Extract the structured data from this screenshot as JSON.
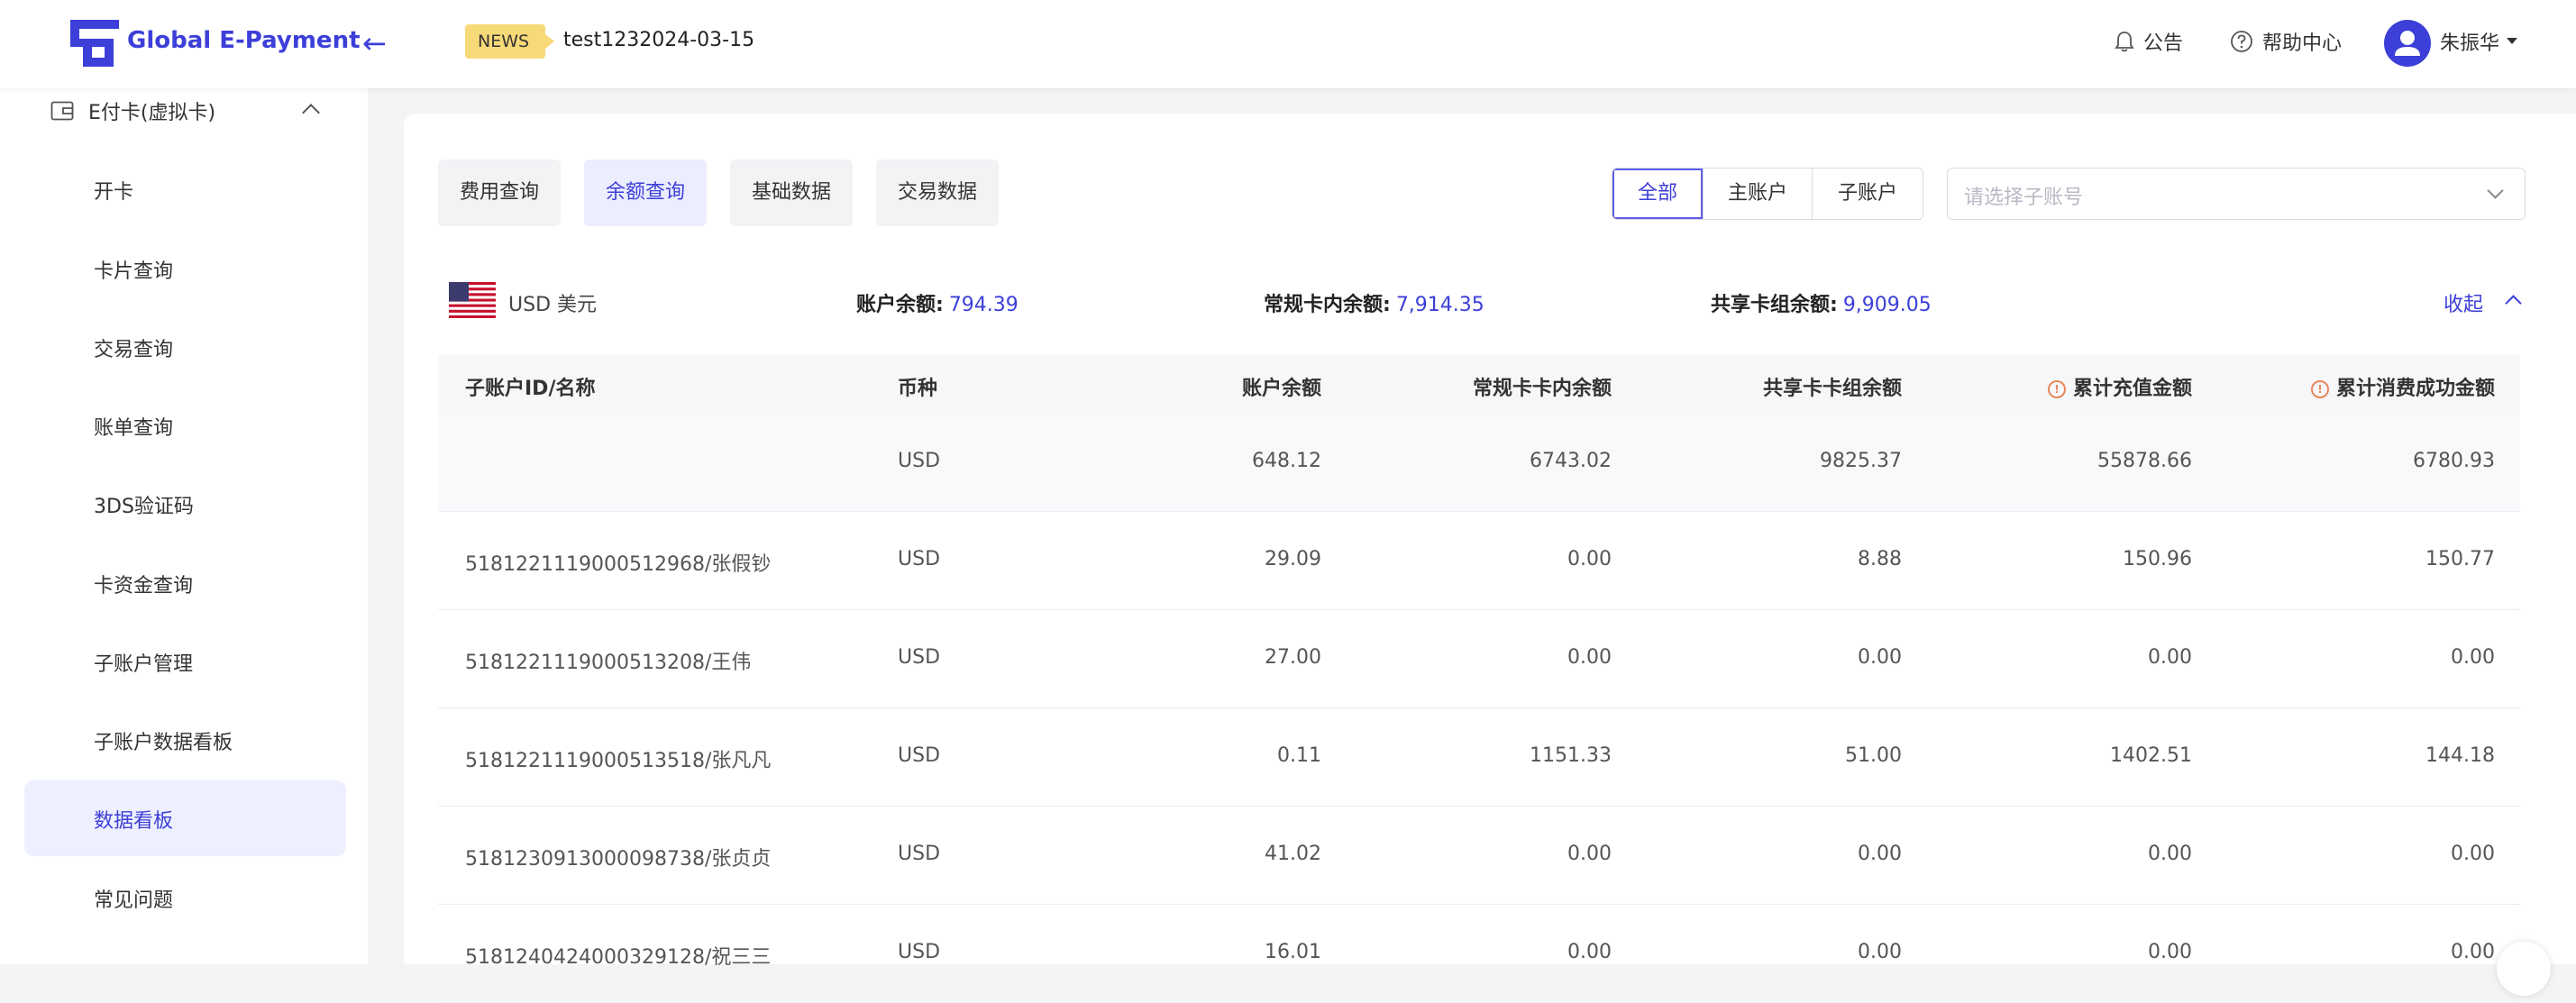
{
  "header": {
    "logo_text": "Global E-Payment",
    "news_badge": "NEWS",
    "news_text": "test1232024-03-15",
    "notice_label": "公告",
    "help_label": "帮助中心",
    "user_name": "朱振华"
  },
  "sidebar": {
    "parent_label": "E付卡(虚拟卡)",
    "items": [
      {
        "label": "开卡"
      },
      {
        "label": "卡片查询"
      },
      {
        "label": "交易查询"
      },
      {
        "label": "账单查询"
      },
      {
        "label": "3DS验证码"
      },
      {
        "label": "卡资金查询"
      },
      {
        "label": "子账户管理"
      },
      {
        "label": "子账户数据看板"
      },
      {
        "label": "数据看板"
      },
      {
        "label": "常见问题"
      }
    ],
    "active_label": "数据看板"
  },
  "tabs": [
    {
      "label": "费用查询"
    },
    {
      "label": "余额查询"
    },
    {
      "label": "基础数据"
    },
    {
      "label": "交易数据"
    }
  ],
  "active_tab": "余额查询",
  "filter": {
    "segments": [
      {
        "label": "全部"
      },
      {
        "label": "主账户"
      },
      {
        "label": "子账户"
      }
    ],
    "active_segment": "全部",
    "placeholder": "请选择子账号"
  },
  "summary": {
    "currency": "USD  美元",
    "account_balance_label": "账户余额:",
    "account_balance_value": "794.39",
    "card_balance_label": "常规卡内余额:",
    "card_balance_value": "7,914.35",
    "shared_balance_label": "共享卡组余额:",
    "shared_balance_value": "9,909.05",
    "collapse_label": "收起"
  },
  "table": {
    "headers": [
      "子账户ID/名称",
      "币种",
      "账户余额",
      "常规卡卡内余额",
      "共享卡卡组余额",
      "累计充值金额",
      "累计消费成功金额"
    ],
    "rows": [
      [
        "",
        "USD",
        "648.12",
        "6743.02",
        "9825.37",
        "55878.66",
        "6780.93"
      ],
      [
        "5181221119000512968/张假钞",
        "USD",
        "29.09",
        "0.00",
        "8.88",
        "150.96",
        "150.77"
      ],
      [
        "5181221119000513208/王伟",
        "USD",
        "27.00",
        "0.00",
        "0.00",
        "0.00",
        "0.00"
      ],
      [
        "5181221119000513518/张凡凡",
        "USD",
        "0.11",
        "1151.33",
        "51.00",
        "1402.51",
        "144.18"
      ],
      [
        "5181230913000098738/张贞贞",
        "USD",
        "41.02",
        "0.00",
        "0.00",
        "0.00",
        "0.00"
      ],
      [
        "5181240424000329128/祝三三",
        "USD",
        "16.01",
        "0.00",
        "0.00",
        "0.00",
        "0.00"
      ]
    ]
  },
  "colors": {
    "accent": "#3c3fd8",
    "news_badge": "#f7d978",
    "warn_icon": "#e9865c"
  }
}
